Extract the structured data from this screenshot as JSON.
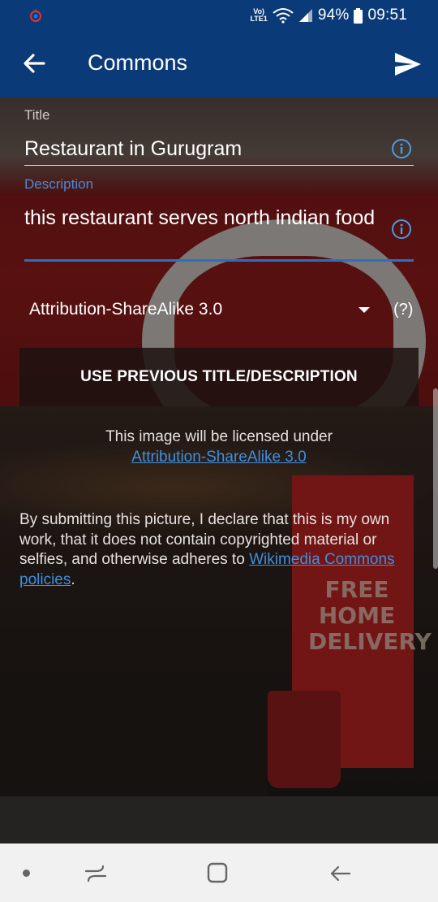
{
  "status_bar": {
    "volte_top": "Vo)",
    "volte_bottom": "LTE1",
    "battery": "94%",
    "time": "09:51",
    "app_icon": "wikimedia-commons-icon"
  },
  "app_bar": {
    "title": "Commons",
    "back_icon": "arrow-left-icon",
    "send_icon": "send-icon",
    "color": "#0b3a78"
  },
  "form": {
    "title_label": "Title",
    "title_value": "Restaurant in Gurugram",
    "description_label": "Description",
    "description_value": "this restaurant serves north indian food",
    "license_value": "Attribution-ShareAlike 3.0",
    "license_help": "(?)",
    "previous_button": "USE PREVIOUS TITLE/DESCRIPTION"
  },
  "license_notice": {
    "text": "This image will be licensed under",
    "link": "Attribution-ShareAlike 3.0"
  },
  "declaration": {
    "text": "By submitting this picture, I declare that this is my own work, that it does not contain copyrighted material or selfies, and otherwise adheres to ",
    "link": "Wikimedia Commons policies",
    "end": "."
  },
  "background_photo": {
    "banner_text": "FREE HOME DELIVERY"
  },
  "colors": {
    "accent": "#2d6fbf",
    "link": "#3f8fe0",
    "fab": "#0f5cad"
  }
}
